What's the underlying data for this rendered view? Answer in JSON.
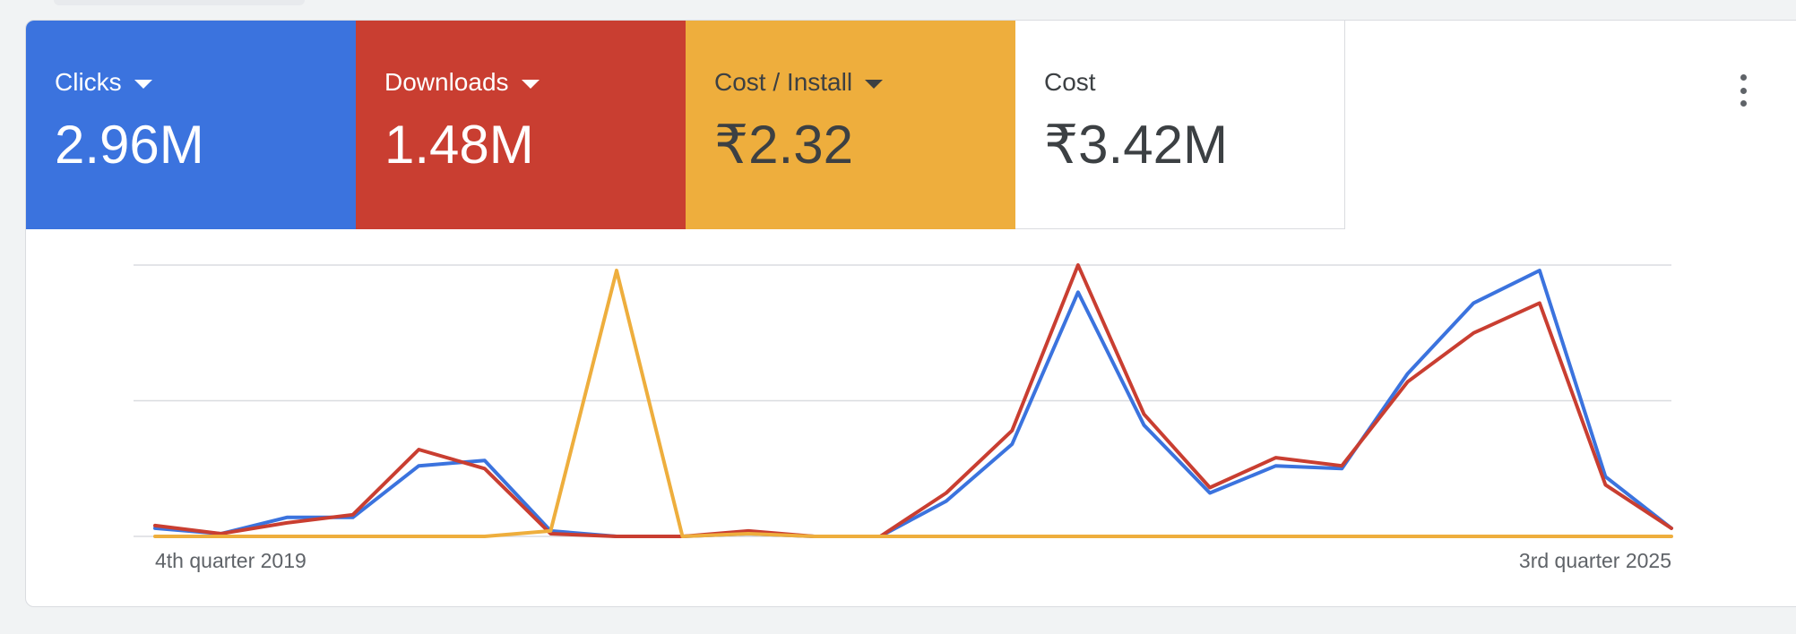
{
  "metrics": [
    {
      "label": "Clicks",
      "value": "2.96M",
      "bg": "#3b73de",
      "fg": "#ffffff",
      "dropdown": true,
      "icon": "caret-down-icon"
    },
    {
      "label": "Downloads",
      "value": "1.48M",
      "bg": "#c93e31",
      "fg": "#ffffff",
      "dropdown": true,
      "icon": "caret-down-icon"
    },
    {
      "label": "Cost / Install",
      "value": "₹2.32",
      "bg": "#eeae3d",
      "fg": "#3c4043",
      "dropdown": true,
      "icon": "caret-down-icon"
    },
    {
      "label": "Cost",
      "value": "₹3.42M",
      "bg": "#ffffff",
      "fg": "#3c4043",
      "dropdown": false
    }
  ],
  "menu_icon": "more-vert-icon",
  "chart_data": {
    "type": "line",
    "x_start_label": "4th quarter 2019",
    "x_end_label": "3rd quarter 2025",
    "ylim": [
      0,
      100
    ],
    "grid": true,
    "series": [
      {
        "color": "#3b73de",
        "values": [
          3,
          1,
          7,
          7,
          26,
          28,
          2,
          0,
          0,
          1,
          0,
          0,
          13,
          34,
          90,
          41,
          16,
          26,
          25,
          60,
          86,
          98,
          22,
          3
        ]
      },
      {
        "color": "#c93e31",
        "values": [
          4,
          1,
          5,
          8,
          32,
          25,
          1,
          0,
          0,
          2,
          0,
          0,
          16,
          39,
          100,
          45,
          18,
          29,
          26,
          57,
          75,
          86,
          19,
          3
        ]
      },
      {
        "color": "#eeae3d",
        "values": [
          0,
          0,
          0,
          0,
          0,
          0,
          2,
          98,
          0,
          1,
          0,
          0,
          0,
          0,
          0,
          0,
          0,
          0,
          0,
          0,
          0,
          0,
          0,
          0
        ]
      }
    ]
  }
}
